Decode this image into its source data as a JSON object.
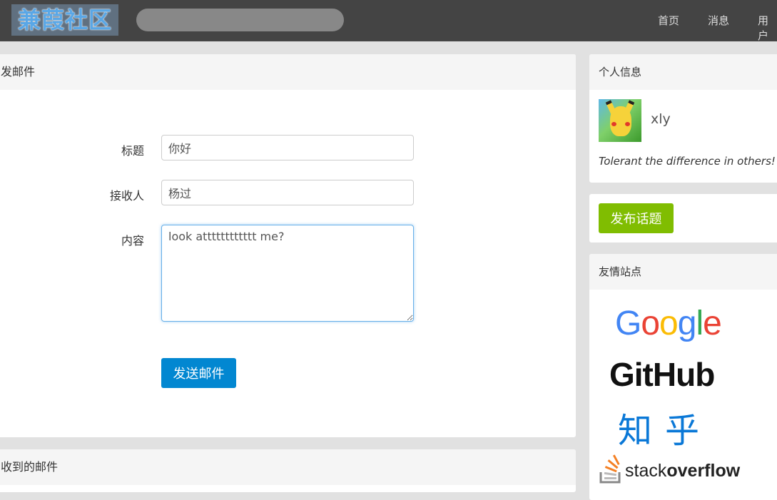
{
  "header": {
    "logo_text": "兼葭社区",
    "search": {
      "value": "",
      "placeholder": ""
    },
    "nav": [
      "首页",
      "消息",
      "用户"
    ]
  },
  "compose": {
    "title": "发邮件",
    "labels": {
      "subject": "标题",
      "recipient": "接收人",
      "content": "内容"
    },
    "values": {
      "subject": "你好",
      "recipient": "杨过",
      "content": "look atttttttttttt me?"
    },
    "send_label": "发送邮件"
  },
  "inbox": {
    "title": "收到的邮件"
  },
  "profile": {
    "title": "个人信息",
    "username": "xly",
    "motto": "Tolerant the difference in others!"
  },
  "publish": {
    "label": "发布话题"
  },
  "links": {
    "title": "友情站点",
    "google": "Google",
    "github": "GitHub",
    "zhihu": "知乎",
    "stackoverflow_prefix": "stack",
    "stackoverflow_suffix": "overflow"
  },
  "colors": {
    "navbar": "#444444",
    "send_button": "#0287d1",
    "publish_button": "#80bd01",
    "google": [
      "#4285f4",
      "#ea4335",
      "#fbbc05",
      "#4285f4",
      "#34a853",
      "#ea4335"
    ]
  },
  "icons": {
    "avatar": "pikachu-avatar",
    "stackoverflow": "stackoverflow-stack-icon"
  }
}
